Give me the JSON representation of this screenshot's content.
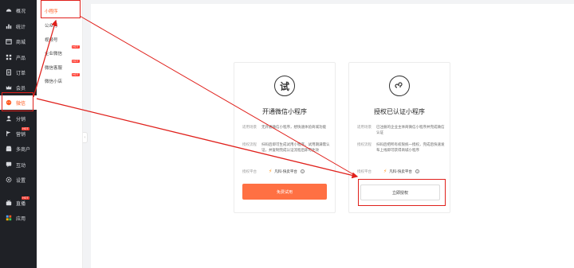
{
  "sidebar": {
    "items": [
      {
        "label": "概况",
        "icon": "dashboard-icon"
      },
      {
        "label": "统计",
        "icon": "stats-icon"
      },
      {
        "label": "商城",
        "icon": "shop-icon"
      },
      {
        "label": "产品",
        "icon": "grid-icon"
      },
      {
        "label": "订单",
        "icon": "order-icon"
      },
      {
        "label": "会员",
        "icon": "crown-icon"
      },
      {
        "label": "微信",
        "icon": "wechat-icon"
      },
      {
        "label": "分销",
        "icon": "people-icon"
      },
      {
        "label": "营销",
        "icon": "flag-icon",
        "hot": "HOT"
      },
      {
        "label": "多商户",
        "icon": "store-icon"
      },
      {
        "label": "互动",
        "icon": "chat-icon"
      },
      {
        "label": "设置",
        "icon": "gear-icon"
      },
      {
        "label": "直播",
        "icon": "live-icon",
        "hot": "HOT"
      },
      {
        "label": "应用",
        "icon": "apps-icon"
      }
    ]
  },
  "subnav": {
    "items": [
      {
        "label": "小程序"
      },
      {
        "label": "公众号"
      },
      {
        "label": "视频号"
      },
      {
        "label": "企业微信",
        "hot": "HOT"
      },
      {
        "label": "微信客服",
        "hot": "HOT"
      },
      {
        "label": "微信小店",
        "hot": "HOT"
      }
    ]
  },
  "cards": [
    {
      "logo_text": "试",
      "title": "开通微信小程序",
      "rows": [
        {
          "k": "适用场景",
          "v": "无开通微信小程序，想快速体验商城功能"
        },
        {
          "k": "授权流程",
          "v": "扫码后即可生成试用小程序，试用期满需认证，并复制完成认证流程后即可生效"
        }
      ],
      "platform_label": "授权平台",
      "platform_name": "凡科-快卖平台",
      "button": "免费试用"
    },
    {
      "logo_text": "",
      "title": "授权已认证小程序",
      "rows": [
        {
          "k": "适用场景",
          "v": "已注册的企业主体商微信小程序并完成微信认证"
        },
        {
          "k": "授权流程",
          "v": "扫码后把所有权限统一授权，完成后快速发布上线即可获得商城小程序"
        }
      ],
      "platform_label": "授权平台",
      "platform_name": "凡科-快卖平台",
      "button": "立即授权"
    }
  ],
  "colors": {
    "accent": "#ff5a1f",
    "sidebar_bg": "#1f2126",
    "annotation": "#e0201b"
  }
}
